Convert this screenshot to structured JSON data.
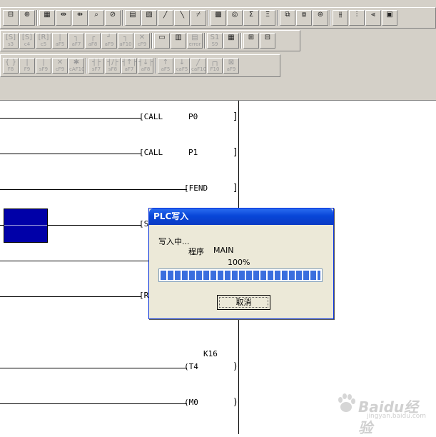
{
  "toolbar": {
    "row1": [
      {
        "name": "monitor-icon",
        "sym": "⊟",
        "sub": ""
      },
      {
        "name": "zoom-icon",
        "sym": "⊕",
        "sub": ""
      },
      {
        "name": "ladder-mode-icon",
        "sym": "▦",
        "sub": ""
      },
      {
        "name": "rung-insert-icon",
        "sym": "⇹",
        "sub": ""
      },
      {
        "name": "rung-delete-icon",
        "sym": "⇻",
        "sub": ""
      },
      {
        "name": "find-icon",
        "sym": "⌕",
        "sub": ""
      },
      {
        "name": "replace-icon",
        "sym": "⊘",
        "sub": ""
      },
      {
        "name": "device-icon",
        "sym": "▤",
        "sub": ""
      },
      {
        "name": "device-comment-icon",
        "sym": "▧",
        "sub": ""
      },
      {
        "name": "line-draw-icon",
        "sym": "╱",
        "sub": ""
      },
      {
        "name": "line-edit-icon",
        "sym": "╲",
        "sub": ""
      },
      {
        "name": "line-delete-icon",
        "sym": "⌿",
        "sub": ""
      },
      {
        "name": "block-icon",
        "sym": "▩",
        "sub": ""
      },
      {
        "name": "online-monitor-icon",
        "sym": "◎",
        "sub": ""
      },
      {
        "name": "sort-asc-icon",
        "sym": "Σ",
        "sub": ""
      },
      {
        "name": "sort-desc-icon",
        "sym": "Ξ",
        "sub": ""
      },
      {
        "name": "window-restore-icon",
        "sym": "⧉",
        "sub": ""
      },
      {
        "name": "window-new-icon",
        "sym": "⧈",
        "sub": ""
      },
      {
        "name": "diagnose-icon",
        "sym": "⊛",
        "sub": ""
      },
      {
        "name": "contact-a-icon",
        "sym": "⫵",
        "sub": ""
      },
      {
        "name": "contact-b-icon",
        "sym": "⫶",
        "sub": ""
      },
      {
        "name": "contact-c-icon",
        "sym": "⫷",
        "sub": ""
      },
      {
        "name": "screen-icon",
        "sym": "▣",
        "sub": ""
      }
    ],
    "row2": [
      {
        "name": "contact-no-icon",
        "sym": "[S]",
        "sub": "s3"
      },
      {
        "name": "contact-c4-icon",
        "sym": "[S]",
        "sub": "c4"
      },
      {
        "name": "contact-c5-icon",
        "sym": "[R]",
        "sub": "c5"
      },
      {
        "name": "vline-af5-icon",
        "sym": "|",
        "sub": "aF5"
      },
      {
        "name": "hline-af7-icon",
        "sym": "┐",
        "sub": "aF7"
      },
      {
        "name": "hline-af8-icon",
        "sym": "┌",
        "sub": "aF8"
      },
      {
        "name": "line-af9-icon",
        "sym": "┘",
        "sub": "aF9"
      },
      {
        "name": "line-af10-icon",
        "sym": "┐",
        "sub": "aF10"
      },
      {
        "name": "cross-cf9-icon",
        "sym": "✕",
        "sub": "cF9"
      },
      {
        "name": "print-icon",
        "sym": "▭",
        "sub": ""
      },
      {
        "name": "printer-icon",
        "sym": "▥",
        "sub": ""
      },
      {
        "name": "error-icon",
        "sym": "▤",
        "sub": "error"
      },
      {
        "name": "s1-s9-icon",
        "sym": "S1",
        "sub": "S9"
      },
      {
        "name": "dev-icon",
        "sym": "▦",
        "sub": ""
      },
      {
        "name": "block-cut-icon",
        "sym": "⊞",
        "sub": ""
      },
      {
        "name": "block-paste-icon",
        "sym": "⊟",
        "sub": ""
      }
    ],
    "row3": [
      {
        "name": "output-f8-icon",
        "sym": "{ }",
        "sub": "F8"
      },
      {
        "name": "contact-f9-icon",
        "sym": "|",
        "sub": "F9"
      },
      {
        "name": "contact-sf9-icon",
        "sym": "|",
        "sub": "sF9"
      },
      {
        "name": "cross-cf9b-icon",
        "sym": "✕",
        "sub": "cF9"
      },
      {
        "name": "cross-caf10-icon",
        "sym": "✱",
        "sub": "cAF10"
      },
      {
        "name": "contact-sf7-icon",
        "sym": "┤├",
        "sub": "sF7"
      },
      {
        "name": "contact-sf8-icon",
        "sym": "┤/├",
        "sub": "sF8"
      },
      {
        "name": "contact-af7-icon",
        "sym": "┤↑├",
        "sub": "aF7"
      },
      {
        "name": "contact-af8-icon",
        "sym": "┤↓├",
        "sub": "aF8"
      },
      {
        "name": "rise-af5-icon",
        "sym": "↑",
        "sub": "aF5"
      },
      {
        "name": "fall-caf5-icon",
        "sym": "↓",
        "sub": "caF5"
      },
      {
        "name": "invert-caf10-icon",
        "sym": "╱",
        "sub": "caF10"
      },
      {
        "name": "f10-icon",
        "sym": "┌┐",
        "sub": "F10"
      },
      {
        "name": "af9-icon",
        "sym": "⊠",
        "sub": "aF9"
      }
    ]
  },
  "ladder": {
    "rungs": [
      {
        "instr": "[CALL",
        "operand": "P0"
      },
      {
        "instr": "[CALL",
        "operand": "P1"
      },
      {
        "instr": "[FEND",
        "operand": ""
      },
      {
        "instr": "[S",
        "operand": ""
      },
      {
        "instr": "",
        "operand": ""
      },
      {
        "instr": "[R",
        "operand": ""
      },
      {
        "instr": "(T4",
        "operand": "",
        "above": "K16"
      },
      {
        "instr": "(M0",
        "operand": ""
      }
    ]
  },
  "dialog": {
    "title": "PLC写入",
    "status": "写入中...",
    "program_label": "程序",
    "program_name": "MAIN",
    "percent_text": "100%",
    "progress_fraction": 1.0,
    "cancel_label": "取消"
  },
  "watermark": {
    "logo": "Baidu经验",
    "sub": "jingyan.baidu.com"
  }
}
